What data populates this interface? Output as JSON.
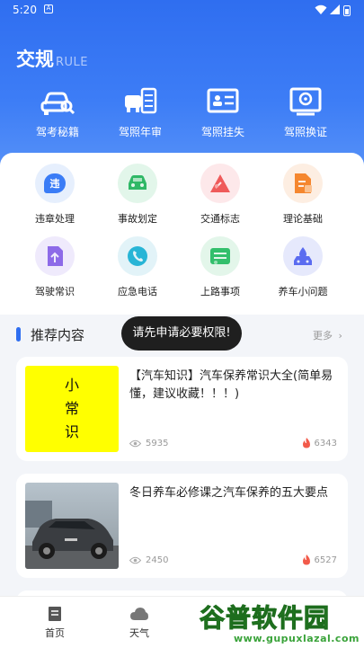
{
  "status_bar": {
    "time": "5:20",
    "notification_badge": "A"
  },
  "header": {
    "title": "交规",
    "subtitle": "RULE"
  },
  "top_nav": [
    {
      "label": "驾考秘籍",
      "icon": "car-search-icon"
    },
    {
      "label": "驾照年审",
      "icon": "car-checklist-icon"
    },
    {
      "label": "驾照挂失",
      "icon": "id-card-icon"
    },
    {
      "label": "驾照换证",
      "icon": "license-steering-icon"
    }
  ],
  "grid": [
    {
      "label": "违章处理",
      "icon": "violation-icon",
      "glyph": "违",
      "bg": "#e6effd",
      "fg": "#3a7cf6"
    },
    {
      "label": "事故划定",
      "icon": "accident-car-icon",
      "glyph": "",
      "bg": "#e2f6ea",
      "fg": "#2fb866"
    },
    {
      "label": "交通标志",
      "icon": "traffic-sign-icon",
      "glyph": "",
      "bg": "#fde8ea",
      "fg": "#ef5a5a"
    },
    {
      "label": "理论基础",
      "icon": "theory-doc-icon",
      "glyph": "",
      "bg": "#fdeee2",
      "fg": "#f5872f"
    },
    {
      "label": "驾驶常识",
      "icon": "driving-tips-icon",
      "glyph": "",
      "bg": "#efeafc",
      "fg": "#8d6ae8"
    },
    {
      "label": "应急电话",
      "icon": "emergency-phone-icon",
      "glyph": "",
      "bg": "#e2f3f8",
      "fg": "#28b5d6"
    },
    {
      "label": "上路事项",
      "icon": "road-notes-icon",
      "glyph": "",
      "bg": "#e3f6ea",
      "fg": "#33bf6c"
    },
    {
      "label": "养车小问题",
      "icon": "car-care-icon",
      "glyph": "",
      "bg": "#e6e9fc",
      "fg": "#5b6cf0"
    }
  ],
  "recommend": {
    "title": "推荐内容",
    "more_label": "更多"
  },
  "toast": "请先申请必要权限!",
  "articles": [
    {
      "title": "【汽车知识】汽车保养常识大全(简单易懂，建议收藏！！！)",
      "thumb_text": [
        "小",
        "常",
        "识"
      ],
      "views": "5935",
      "hot": "6343"
    },
    {
      "title": "冬日养车必修课之汽车保养的五大要点",
      "thumb_text": [],
      "views": "2450",
      "hot": "6527"
    }
  ],
  "bottom_tabs": [
    {
      "label": "首页",
      "icon": "home-doc-icon"
    },
    {
      "label": "天气",
      "icon": "cloud-icon"
    }
  ],
  "watermark": {
    "text": "谷普软件园",
    "url": "www.gupuxlazal.com"
  },
  "colors": {
    "primary": "#2f6ef0",
    "hot": "#f25a4a"
  }
}
